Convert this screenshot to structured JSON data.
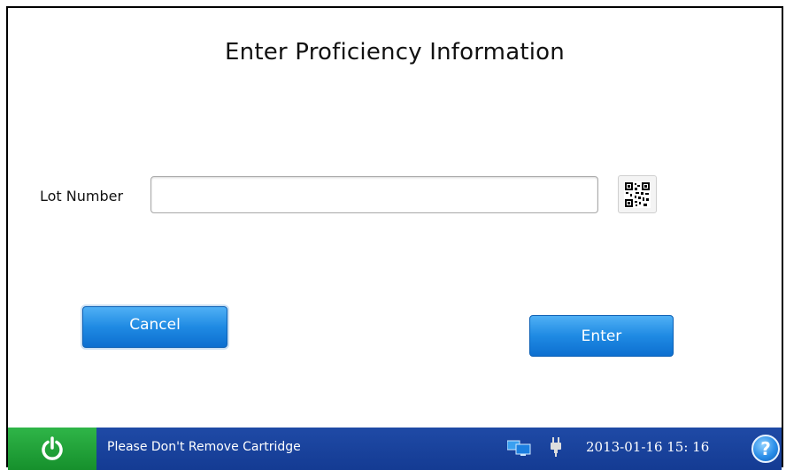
{
  "screen": {
    "title": "Enter Proficiency Information"
  },
  "form": {
    "lot_label": "Lot Number",
    "lot_value": "",
    "lot_placeholder": ""
  },
  "buttons": {
    "cancel_label": "Cancel",
    "enter_label": "Enter"
  },
  "statusbar": {
    "message": "Please Don't Remove Cartridge",
    "datetime": "2013-01-16  15: 16",
    "help_label": "?",
    "icons": [
      "power-icon",
      "network-icon",
      "power-plug-icon",
      "help-icon"
    ]
  },
  "colors": {
    "button_blue": "#1f8ae3",
    "statusbar_blue": "#143b93",
    "power_green": "#16902c"
  }
}
